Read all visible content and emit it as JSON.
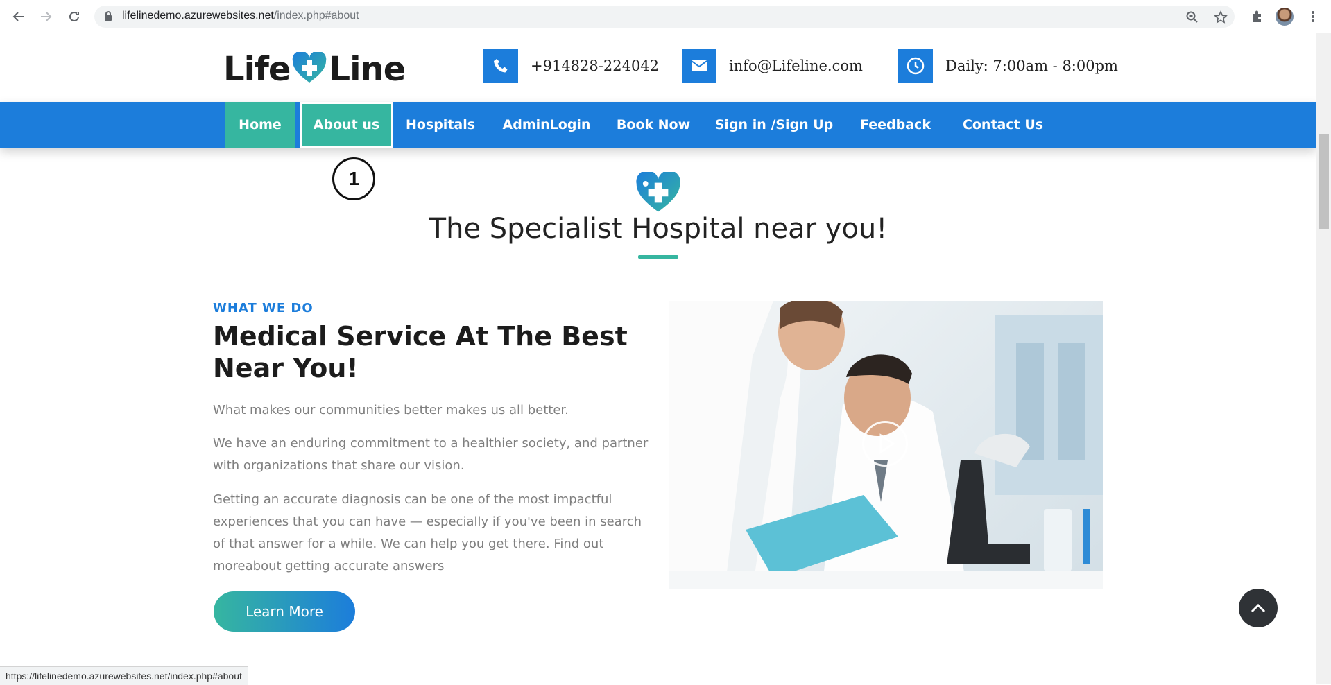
{
  "browser": {
    "url_host": "lifelinedemo.azurewebsites.net",
    "url_path": "/index.php#about",
    "icons": [
      "back-icon",
      "forward-icon",
      "reload-icon",
      "lock-icon",
      "zoom-icon",
      "star-icon",
      "extensions-icon",
      "menu-icon"
    ]
  },
  "header": {
    "logo_part1": "Life",
    "logo_part2": "Line",
    "phone": "+914828-224042",
    "email": "info@Lifeline.com",
    "hours": "Daily: 7:00am - 8:00pm"
  },
  "nav": {
    "items": [
      {
        "label": "Home"
      },
      {
        "label": "About us"
      },
      {
        "label": "Hospitals"
      },
      {
        "label": "AdminLogin"
      },
      {
        "label": "Book Now"
      },
      {
        "label": "Sign in /Sign Up"
      },
      {
        "label": "Feedback"
      },
      {
        "label": "Contact Us"
      }
    ]
  },
  "annotation": {
    "label": "1"
  },
  "section": {
    "title": "The Specialist Hospital near you!"
  },
  "about": {
    "eyebrow": "WHAT WE DO",
    "headline": "Medical Service At The Best Near You!",
    "p1": "What makes our communities better makes us all better.",
    "p2": "We have an enduring commitment to a healthier society, and partner with organizations that share our vision.",
    "p3": "Getting an accurate diagnosis can be one of the most impactful experiences that you can have — especially if you've been in search of that answer for a while. We can help you get there. Find out moreabout getting accurate answers",
    "button": "Learn More"
  },
  "status_bar": {
    "link": "https://lifelinedemo.azurewebsites.net/index.php#about"
  },
  "colors": {
    "primary_blue": "#1c7ddb",
    "teal": "#36b6a0",
    "dark": "#1c1c1c"
  }
}
